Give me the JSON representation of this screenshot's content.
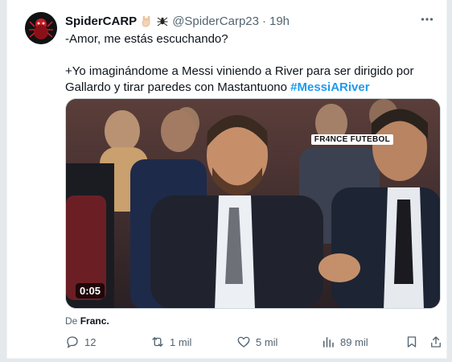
{
  "tweet": {
    "display_name": "SpiderCARP",
    "handle": "@SpiderCarp23",
    "separator": "·",
    "time": "19h",
    "line1": "-Amor, me estás escuchando?",
    "line2_text": "+Yo imaginándome a Messi viniendo a River para ser dirigido por Gallardo y tirar paredes con Mastantuono ",
    "hashtag": "#MessiARiver",
    "emoji_icons": [
      "rock-hand-emoji-icon",
      "spider-emoji-icon"
    ]
  },
  "media": {
    "watermark": "FR4NCE FUTEBOL",
    "duration": "0:05"
  },
  "source": {
    "prefix": "De",
    "name": "Franc."
  },
  "actions": {
    "replies": "12",
    "reposts": "1 mil",
    "likes": "5 mil",
    "views": "89 mil"
  },
  "colors": {
    "accent": "#1d9bf0",
    "muted": "#536471",
    "text": "#0f1419"
  }
}
